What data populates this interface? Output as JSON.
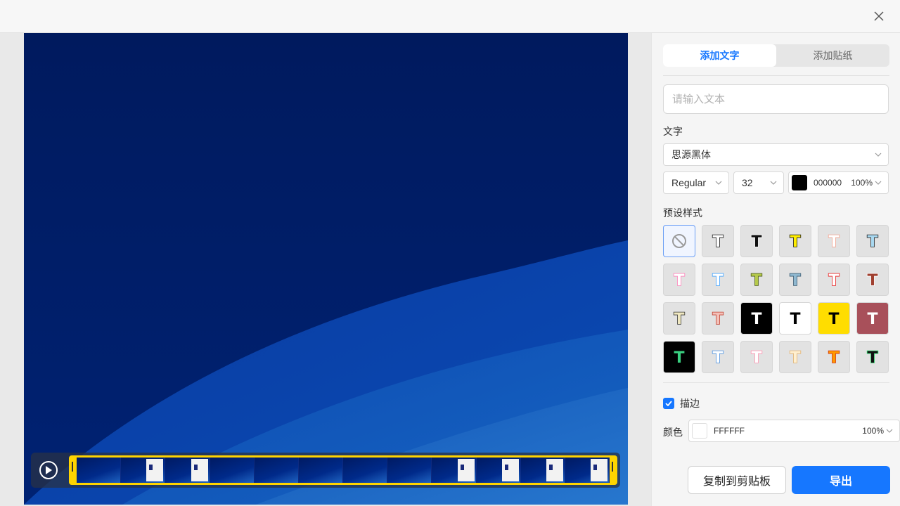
{
  "window": {
    "close_icon": "close-icon"
  },
  "panel": {
    "tabs": [
      {
        "label": "添加文字",
        "active": true
      },
      {
        "label": "添加贴纸",
        "active": false
      }
    ],
    "text_input": {
      "placeholder": "请输入文本",
      "value": ""
    },
    "text_section": {
      "label": "文字",
      "font_family": "思源黑体",
      "font_weight": "Regular",
      "font_size": "32",
      "color_hex": "000000",
      "color_value": "#000000",
      "opacity": "100%"
    },
    "preset_section": {
      "label": "预设样式",
      "presets": [
        {
          "kind": "none",
          "bg": "#f0f5ff",
          "fill": "",
          "stroke": "",
          "selected": true
        },
        {
          "kind": "t",
          "bg": "#e2e2e2",
          "fill": "#ffffff",
          "stroke": "#111111"
        },
        {
          "kind": "t",
          "bg": "#e2e2e2",
          "fill": "#111111",
          "stroke": "#ffffff"
        },
        {
          "kind": "t",
          "bg": "#e2e2e2",
          "fill": "#ffee00",
          "stroke": "#111111"
        },
        {
          "kind": "t",
          "bg": "#e2e2e2",
          "fill": "#ffffff",
          "stroke": "#f2a08c"
        },
        {
          "kind": "t",
          "bg": "#e2e2e2",
          "fill": "#a8d8f0",
          "stroke": "#222222"
        },
        {
          "kind": "t",
          "bg": "#e2e2e2",
          "fill": "#ffffff",
          "stroke": "#ff7eb8"
        },
        {
          "kind": "t",
          "bg": "#e2e2e2",
          "fill": "#ffffff",
          "stroke": "#3aa0ff"
        },
        {
          "kind": "t",
          "bg": "#e2e2e2",
          "fill": "#b5c94a",
          "stroke": "#4a5a1a"
        },
        {
          "kind": "t",
          "bg": "#e2e2e2",
          "fill": "#8fb8d0",
          "stroke": "#3a5a70"
        },
        {
          "kind": "t",
          "bg": "#e2e2e2",
          "fill": "#ffffff",
          "stroke": "#e81818"
        },
        {
          "kind": "t",
          "bg": "#e2e2e2",
          "fill": "#a04030",
          "stroke": "#ffffff"
        },
        {
          "kind": "t",
          "bg": "#e2e2e2",
          "fill": "#f0e8c0",
          "stroke": "#333333"
        },
        {
          "kind": "t",
          "bg": "#e2e2e2",
          "fill": "#f3c0b8",
          "stroke": "#c04030"
        },
        {
          "kind": "t",
          "bg": "#000000",
          "fill": "#ffffff",
          "stroke": "#000000"
        },
        {
          "kind": "t",
          "bg": "#ffffff",
          "fill": "#000000",
          "stroke": "#ffffff"
        },
        {
          "kind": "t",
          "bg": "#ffdd00",
          "fill": "#000000",
          "stroke": "#ffdd00"
        },
        {
          "kind": "t",
          "bg": "#a8505a",
          "fill": "#ffffff",
          "stroke": "#a8505a"
        },
        {
          "kind": "t",
          "bg": "#000000",
          "fill": "#3ad080",
          "stroke": "#000000"
        },
        {
          "kind": "t",
          "bg": "#e2e2e2",
          "fill": "#ffffff",
          "stroke": "#4a90e0"
        },
        {
          "kind": "t",
          "bg": "#e2e2e2",
          "fill": "#ffffff",
          "stroke": "#ff90b0"
        },
        {
          "kind": "t",
          "bg": "#e2e2e2",
          "fill": "#fff0d0",
          "stroke": "#e0b070"
        },
        {
          "kind": "t",
          "bg": "#e2e2e2",
          "fill": "#ff9900",
          "stroke": "#d03010"
        },
        {
          "kind": "t",
          "bg": "#e2e2e2",
          "fill": "#111111",
          "stroke": "#30e070"
        }
      ]
    },
    "stroke_section": {
      "label": "描边",
      "checked": true,
      "color_label": "颜色",
      "color_hex": "FFFFFF",
      "color_value": "#ffffff",
      "opacity": "100%"
    },
    "buttons": {
      "copy": "复制到剪贴板",
      "export": "导出"
    }
  },
  "preview": {
    "timeline_frames": 12,
    "frames_with_document": [
      2,
      3,
      9,
      10,
      11,
      12
    ]
  }
}
